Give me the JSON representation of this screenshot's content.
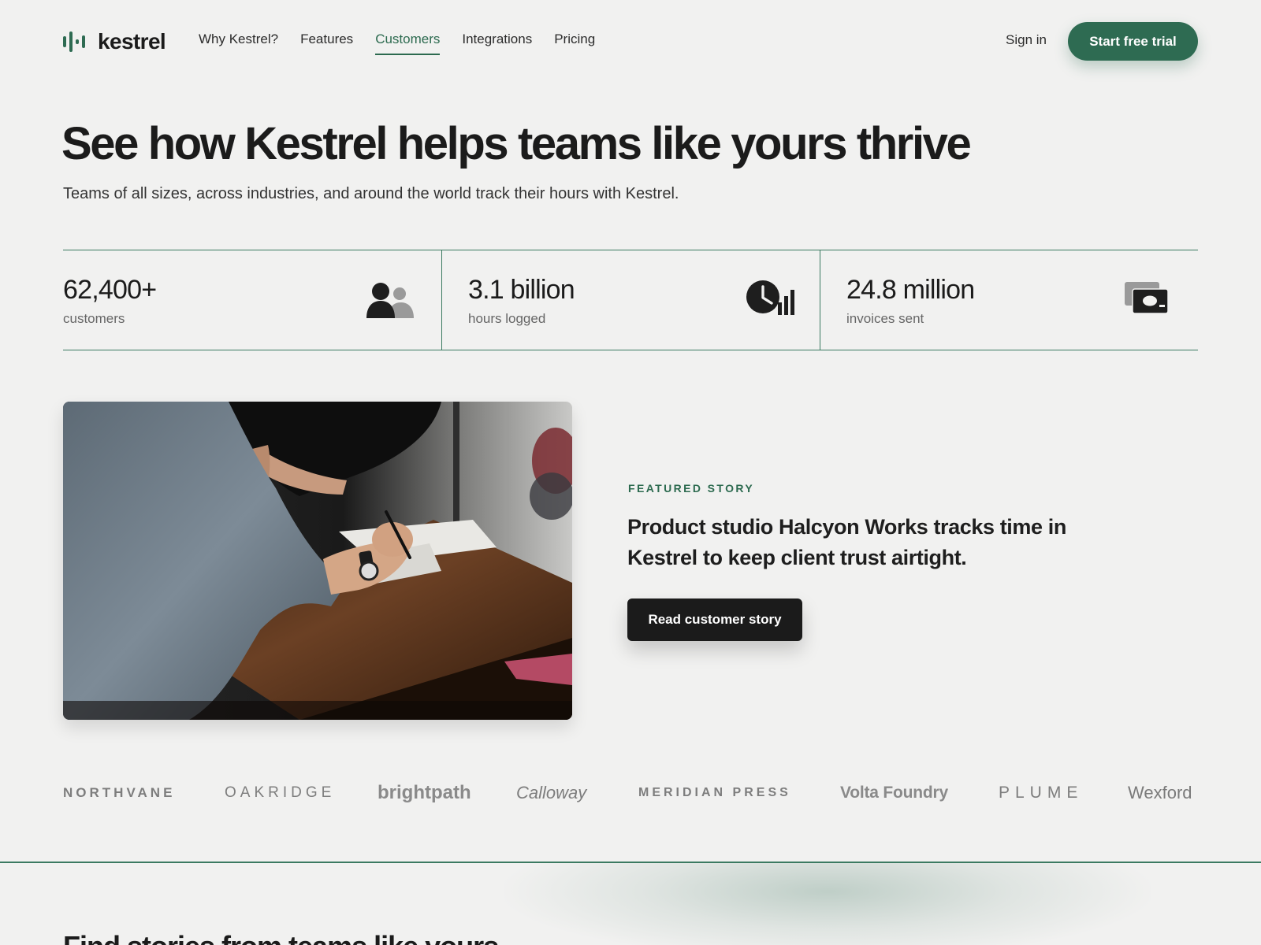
{
  "brand": {
    "name": "kestrel",
    "accent": "#2e6b52",
    "dark": "#1b1b1b"
  },
  "nav": {
    "items": [
      {
        "label": "Why Kestrel?",
        "active": false
      },
      {
        "label": "Features",
        "active": false
      },
      {
        "label": "Customers",
        "active": true
      },
      {
        "label": "Integrations",
        "active": false
      },
      {
        "label": "Pricing",
        "active": false
      }
    ],
    "sign_in": "Sign in",
    "cta": "Start free trial"
  },
  "hero": {
    "title": "See how Kestrel helps teams like yours thrive",
    "subtitle": "Teams of all sizes, across industries, and around the world track their hours with Kestrel."
  },
  "stats": [
    {
      "value": "62,400+",
      "label": "customers",
      "icon": "people-icon"
    },
    {
      "value": "3.1 billion",
      "label": "hours logged",
      "icon": "clock-chart-icon"
    },
    {
      "value": "24.8 million",
      "label": "invoices sent",
      "icon": "cash-icon"
    }
  ],
  "featured": {
    "eyebrow": "FEATURED STORY",
    "title": "Product studio Halcyon Works tracks time in Kestrel to keep client trust airtight.",
    "button": "Read customer story"
  },
  "logos": [
    "NORTHVANE",
    "OAKRIDGE",
    "brightpath",
    "Calloway",
    "MERIDIAN PRESS",
    "Volta Foundry",
    "PLUME",
    "Wexford"
  ],
  "next_section": {
    "heading": "Find stories from teams like yours"
  }
}
